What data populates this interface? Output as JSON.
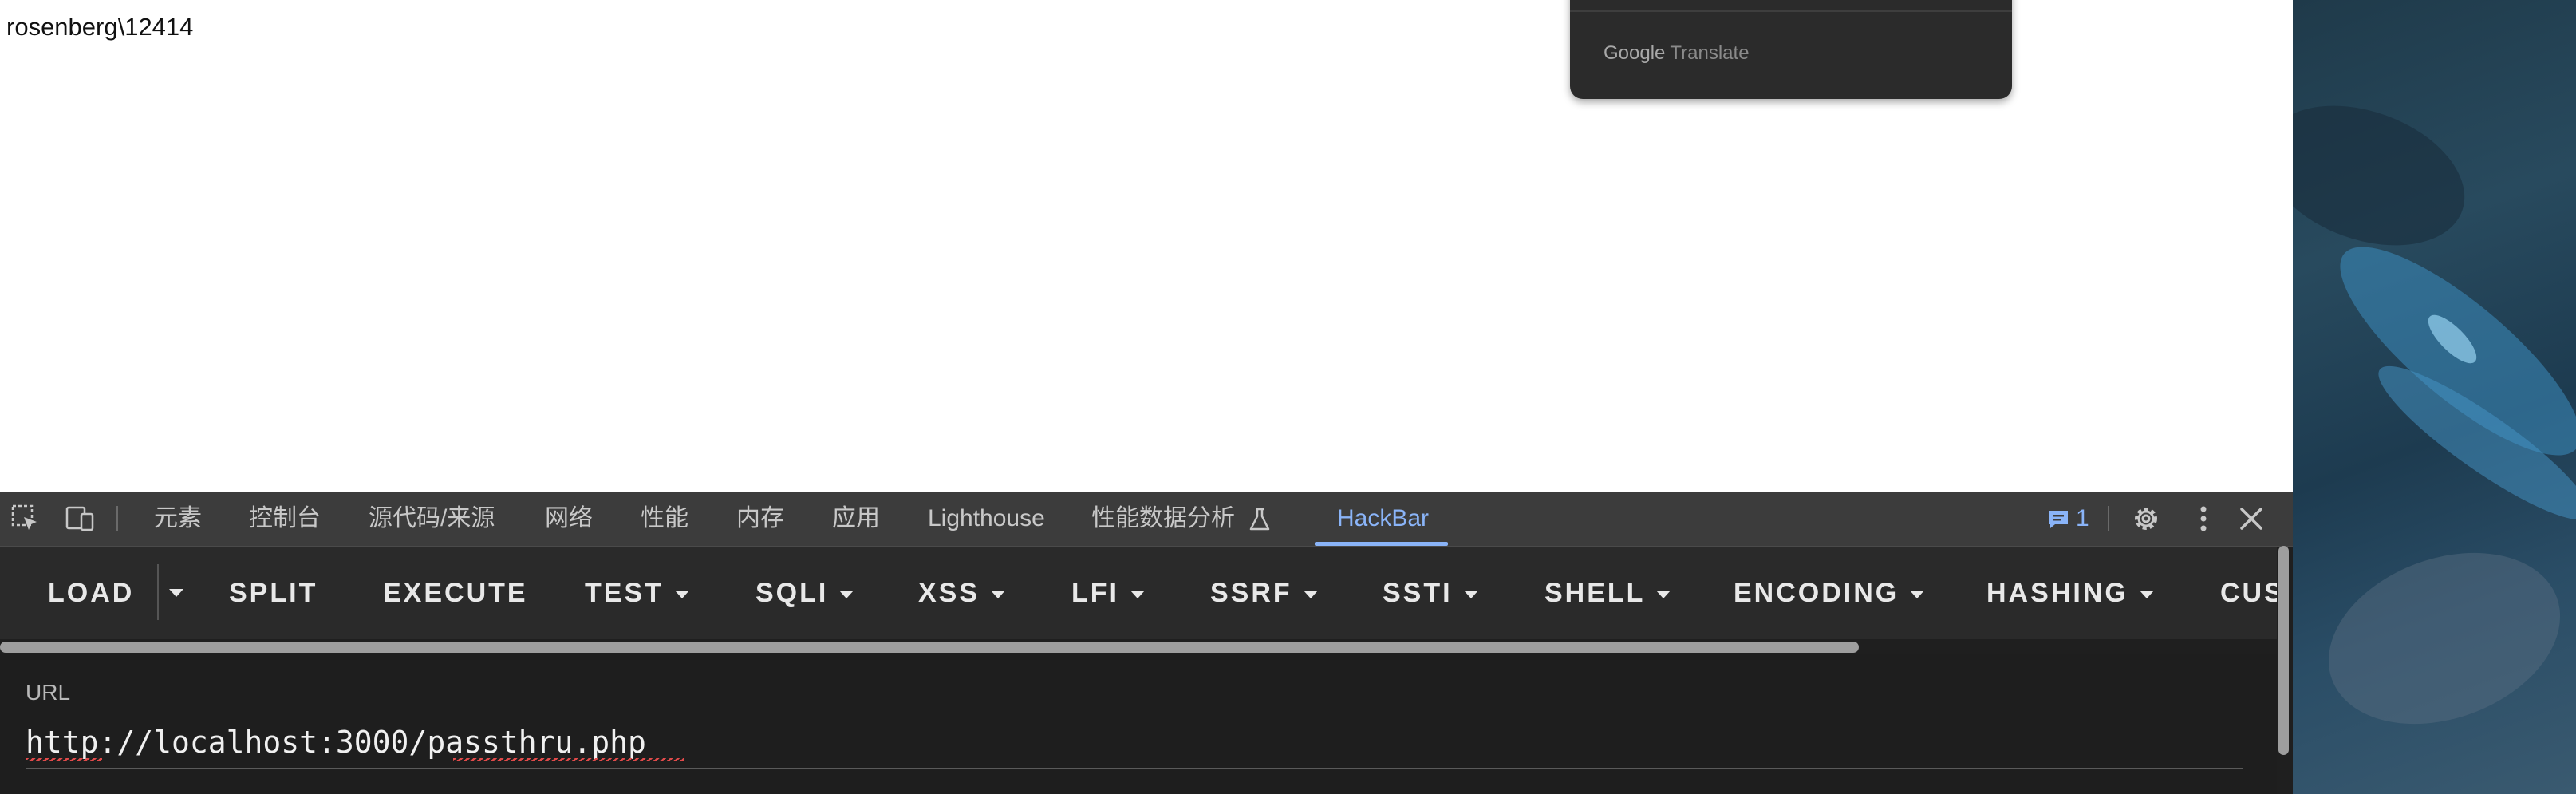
{
  "page": {
    "text": "rosenberg\\12414"
  },
  "translate_popup": {
    "brand_google": "Google",
    "brand_translate": "Translate"
  },
  "devtools": {
    "tabs": [
      {
        "label": "元素"
      },
      {
        "label": "控制台"
      },
      {
        "label": "源代码/来源"
      },
      {
        "label": "网络"
      },
      {
        "label": "性能"
      },
      {
        "label": "内存"
      },
      {
        "label": "应用"
      },
      {
        "label": "Lighthouse"
      },
      {
        "label": "性能数据分析"
      },
      {
        "label": "HackBar"
      }
    ],
    "active_tab": "HackBar",
    "issues_count": "1",
    "accent_color": "#8ab4f8"
  },
  "hackbar": {
    "buttons": [
      {
        "label": "LOAD"
      },
      {
        "label": "SPLIT"
      },
      {
        "label": "EXECUTE"
      },
      {
        "label": "TEST"
      },
      {
        "label": "SQLI"
      },
      {
        "label": "XSS"
      },
      {
        "label": "LFI"
      },
      {
        "label": "SSRF"
      },
      {
        "label": "SSTI"
      },
      {
        "label": "SHELL"
      },
      {
        "label": "ENCODING"
      },
      {
        "label": "HASHING"
      },
      {
        "label": "CUS"
      }
    ],
    "url_label": "URL",
    "url_value": "http://localhost:3000/passthru.php"
  }
}
